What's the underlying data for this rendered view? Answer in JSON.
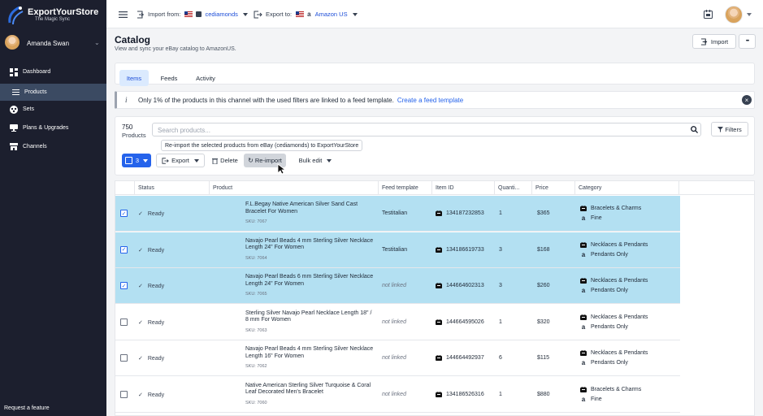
{
  "app": {
    "logo_title": "ExportYourStore",
    "logo_subtitle": "The Magic Sync"
  },
  "user": {
    "name": "Amanda Swan"
  },
  "sidebar": {
    "items": [
      {
        "label": "Dashboard",
        "icon": "dashboard-icon"
      },
      {
        "label": "Products",
        "icon": "list-icon",
        "active": true
      },
      {
        "label": "Sets",
        "icon": "sets-icon"
      },
      {
        "label": "Plans & Upgrades",
        "icon": "monitor-icon"
      },
      {
        "label": "Channels",
        "icon": "store-icon"
      }
    ],
    "request_feature": "Request a feature"
  },
  "topbar": {
    "import_label": "Import from:",
    "import_channel": "cediamonds",
    "export_label": "Export to:",
    "export_channel": "Amazon US"
  },
  "page": {
    "title": "Catalog",
    "subtitle": "View and sync your eBay catalog to AmazonUS.",
    "import_button": "Import",
    "more_button": "•••"
  },
  "tabs": [
    {
      "label": "Items",
      "active": true
    },
    {
      "label": "Feeds"
    },
    {
      "label": "Activity"
    }
  ],
  "info": {
    "text": "Only 1% of the products in this channel with the used filters are linked to a feed template.",
    "link": "Create a feed template"
  },
  "toolbar": {
    "count": "750",
    "count_label": "Products",
    "search_placeholder": "Search products...",
    "filters_label": "Filters",
    "tooltip": "Re-import the selected products from eBay (cediamonds) to ExportYourStore",
    "selected_count": "3",
    "export_label": "Export",
    "delete_label": "Delete",
    "reimport_label": "Re-import",
    "bulk_edit_label": "Bulk edit"
  },
  "table": {
    "headers": [
      "Status",
      "Product",
      "Feed template",
      "Item ID",
      "Quanti...",
      "Price",
      "Category"
    ],
    "rows": [
      {
        "selected": true,
        "status": "Ready",
        "name": "F.L.Begay Native American Silver Sand Cast Bracelet For Women",
        "sku": "SKU: 7067",
        "template": "Testitalian",
        "item_id": "134187232853",
        "qty": "1",
        "price": "$365",
        "cat_ebay": "Bracelets & Charms",
        "cat_amazon": "Fine"
      },
      {
        "selected": true,
        "status": "Ready",
        "name": "Navajo Pearl Beads 4 mm Sterling Silver Necklace Length 24\" For Women",
        "sku": "SKU: 7064",
        "template": "Testitalian",
        "item_id": "134186619733",
        "qty": "3",
        "price": "$168",
        "cat_ebay": "Necklaces & Pendants",
        "cat_amazon": "Pendants Only"
      },
      {
        "selected": true,
        "status": "Ready",
        "name": "Navajo Pearl Beads 6 mm Sterling Silver Necklace Length 24\" For Women",
        "sku": "SKU: 7065",
        "template": "not linked",
        "item_id": "144664602313",
        "qty": "3",
        "price": "$260",
        "cat_ebay": "Necklaces & Pendants",
        "cat_amazon": "Pendants Only"
      },
      {
        "selected": false,
        "status": "Ready",
        "name": "Sterling Silver Navajo Pearl Necklace Length 18\" / 8 mm For Women",
        "sku": "SKU: 7063",
        "template": "not linked",
        "item_id": "144664595026",
        "qty": "1",
        "price": "$320",
        "cat_ebay": "Necklaces & Pendants",
        "cat_amazon": "Pendants Only"
      },
      {
        "selected": false,
        "status": "Ready",
        "name": "Navajo Pearl Beads 4 mm Sterling Silver Necklace Length 16\" For Women",
        "sku": "SKU: 7062",
        "template": "not linked",
        "item_id": "144664492937",
        "qty": "6",
        "price": "$115",
        "cat_ebay": "Necklaces & Pendants",
        "cat_amazon": "Pendants Only"
      },
      {
        "selected": false,
        "status": "Ready",
        "name": "Native American Sterling Silver Turquoise & Coral Leaf Decorated Men's Bracelet",
        "sku": "SKU: 7060",
        "template": "not linked",
        "item_id": "134186526316",
        "qty": "1",
        "price": "$880",
        "cat_ebay": "Bracelets & Charms",
        "cat_amazon": "Fine"
      }
    ]
  },
  "colors": {
    "sidebar_bg": "#1c1f2e",
    "active_nav": "#3b4a62",
    "selected_row": "#b3e0f2",
    "link": "#2563eb"
  }
}
